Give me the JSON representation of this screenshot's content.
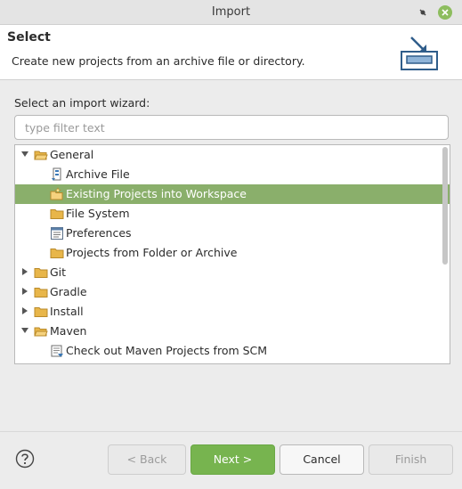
{
  "window": {
    "title": "Import"
  },
  "header": {
    "title": "Select",
    "description": "Create new projects from an archive file or directory."
  },
  "wizard": {
    "label": "Select an import wizard:",
    "filter_placeholder": "type filter text",
    "filter_value": ""
  },
  "tree": {
    "items": [
      {
        "label": "General",
        "level": 0,
        "expanded": true,
        "icon": "folder-open-icon"
      },
      {
        "label": "Archive File",
        "level": 1,
        "icon": "archive-file-icon"
      },
      {
        "label": "Existing Projects into Workspace",
        "level": 1,
        "icon": "existing-projects-icon",
        "selected": true
      },
      {
        "label": "File System",
        "level": 1,
        "icon": "folder-icon"
      },
      {
        "label": "Preferences",
        "level": 1,
        "icon": "preferences-icon"
      },
      {
        "label": "Projects from Folder or Archive",
        "level": 1,
        "icon": "folder-icon"
      },
      {
        "label": "Git",
        "level": 0,
        "expanded": false,
        "icon": "folder-icon"
      },
      {
        "label": "Gradle",
        "level": 0,
        "expanded": false,
        "icon": "folder-icon"
      },
      {
        "label": "Install",
        "level": 0,
        "expanded": false,
        "icon": "folder-icon"
      },
      {
        "label": "Maven",
        "level": 0,
        "expanded": true,
        "icon": "folder-open-icon"
      },
      {
        "label": "Check out Maven Projects from SCM",
        "level": 1,
        "icon": "maven-scm-icon"
      }
    ]
  },
  "buttons": {
    "back": "< Back",
    "next": "Next >",
    "cancel": "Cancel",
    "finish": "Finish"
  },
  "colors": {
    "selection": "#8aaf6b",
    "primary_button": "#77b44f",
    "folder": "#e8b64a"
  }
}
